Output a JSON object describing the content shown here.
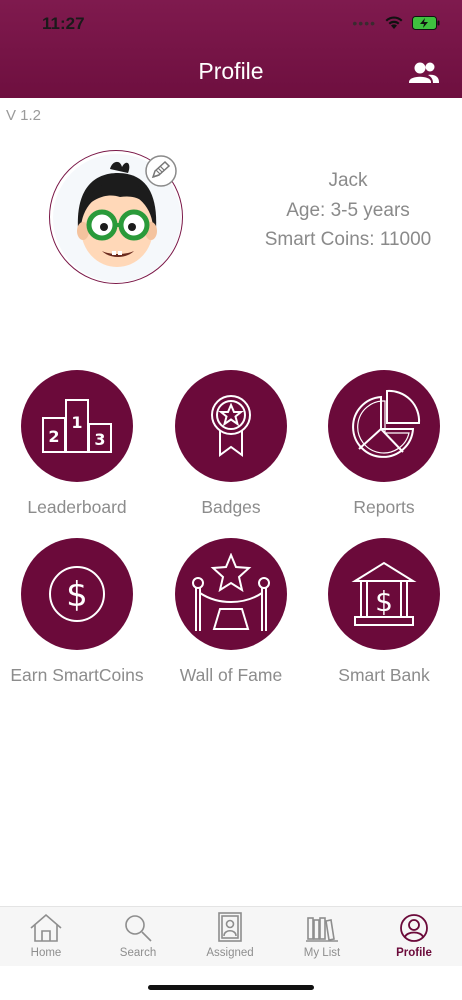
{
  "status_bar": {
    "time": "11:27",
    "signal": "••••"
  },
  "header": {
    "title": "Profile"
  },
  "version": "V 1.2",
  "profile": {
    "name": "Jack",
    "age": "Age: 3-5 years",
    "coins": "Smart Coins: 11000"
  },
  "tiles": [
    {
      "label": "Leaderboard",
      "icon": "podium-icon"
    },
    {
      "label": "Badges",
      "icon": "badge-ribbon-icon"
    },
    {
      "label": "Reports",
      "icon": "pie-chart-icon"
    },
    {
      "label": "Earn SmartCoins",
      "icon": "dollar-coin-icon"
    },
    {
      "label": "Wall of Fame",
      "icon": "star-rope-icon"
    },
    {
      "label": "Smart Bank",
      "icon": "bank-icon"
    }
  ],
  "tab_bar": {
    "items": [
      {
        "label": "Home",
        "icon": "home-icon"
      },
      {
        "label": "Search",
        "icon": "search-icon"
      },
      {
        "label": "Assigned",
        "icon": "assigned-icon"
      },
      {
        "label": "My List",
        "icon": "books-icon"
      },
      {
        "label": "Profile",
        "icon": "profile-icon",
        "active": true
      }
    ]
  },
  "colors": {
    "brand": "#6b0a3a",
    "header": "#7f1a4e",
    "muted_text": "#8c8c8c"
  }
}
